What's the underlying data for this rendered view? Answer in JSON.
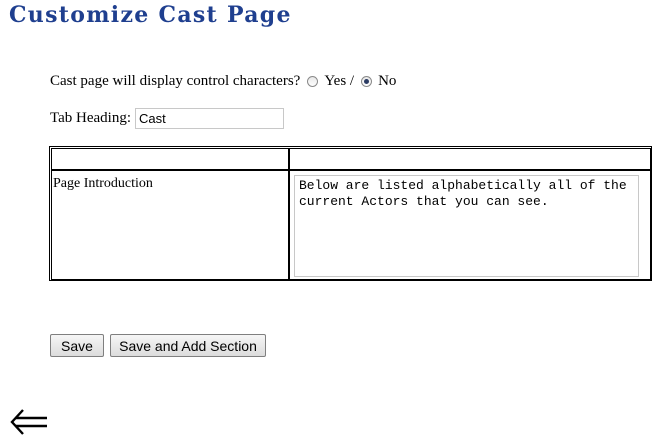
{
  "page": {
    "title": "Customize Cast Page"
  },
  "display_control": {
    "label": "Cast page will display control characters?",
    "option_yes": "Yes /",
    "option_no": "No",
    "selected": "No"
  },
  "tab_heading": {
    "label": "Tab Heading:",
    "value": "Cast"
  },
  "table": {
    "header": [
      "",
      ""
    ],
    "rows": [
      {
        "label": "Page Introduction",
        "value": "Below are listed alphabetically all of the current Actors that you can see."
      }
    ]
  },
  "buttons": {
    "save_label": "Save",
    "save_add_label": "Save and Add Section"
  },
  "navigation": {
    "back_icon": "back-arrow-icon"
  },
  "colors": {
    "title": "#1f3f8f"
  }
}
